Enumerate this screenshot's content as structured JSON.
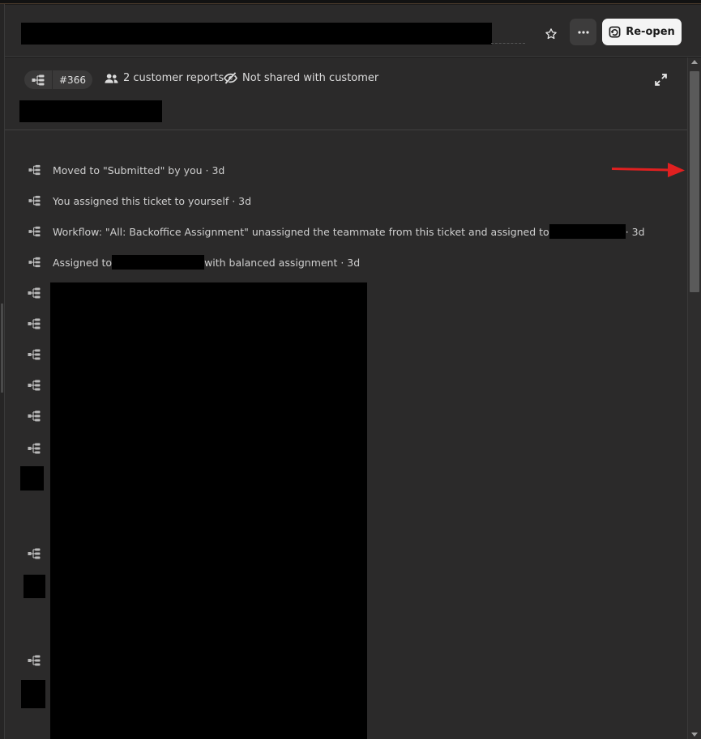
{
  "header": {
    "title_redacted": true,
    "reopen_label": "Re-open"
  },
  "meta": {
    "ticket_number": "#366",
    "customer_reports": "2 customer reports",
    "shared_status": "Not shared with customer"
  },
  "events": [
    {
      "text": "Moved to \"Submitted\" by you · 3d"
    },
    {
      "text": "You assigned this ticket to yourself · 3d"
    },
    {
      "prefix": "Workflow: \"All: Backoffice Assignment\" unassigned the teammate from this ticket and assigned to",
      "suffix": " · 3d"
    },
    {
      "prefix": "Assigned to",
      "suffix": "with balanced assignment · 3d"
    }
  ],
  "icons": {
    "workflow": "workflow-icon",
    "star": "star-icon",
    "more": "more-horizontal-icon",
    "reopen": "reopen-icon",
    "people": "people-icon",
    "eye_off": "eye-off-icon",
    "expand": "expand-icon"
  },
  "colors": {
    "background": "#2b2a2a",
    "reopen_button_bg": "#f4f4f4",
    "annotation_arrow": "#e02020"
  }
}
